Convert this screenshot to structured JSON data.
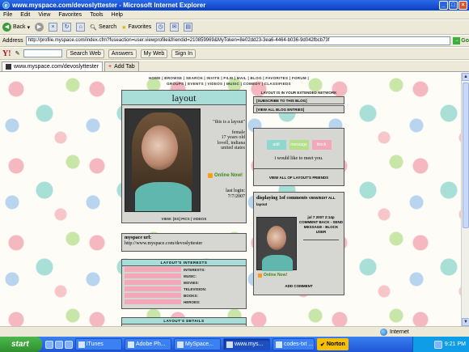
{
  "window": {
    "title": "www.myspace.com/devoslyttester - Microsoft Internet Explorer"
  },
  "menu": [
    "File",
    "Edit",
    "View",
    "Favorites",
    "Tools",
    "Help"
  ],
  "toolbar": {
    "back_label": "Back",
    "search_label": "Search",
    "favorites_label": "Favorites"
  },
  "address": {
    "label": "Address",
    "url": "http://profile.myspace.com/index.cfm?fuseaction=user.viewprofile&friendid=210859969&MyToken=8e02dd23-3ea6-4464-b036-9d042fbcb73f",
    "go_label": "Go"
  },
  "yahoo_toolbar": {
    "search_web_label": "Search Web",
    "answers_label": "Answers",
    "my_web_label": "My Web",
    "sign_in_label": "Sign In"
  },
  "tabs": [
    {
      "label": "www.myspace.com/devoslyttester"
    },
    {
      "label": "Add Tab"
    }
  ],
  "page": {
    "top_nav": "HOME | BROWSE | SEARCH | INVITE | FILM | MAIL | BLOG | FAVORITES | FORUM | GROUPS | EVENTS | VIDEOS | MUSIC | COMEDY | CLASSIFIEDS",
    "profile": {
      "title": "layout",
      "quote": "\"this is a layout\"",
      "details": "female\n17 years old\nlovell, indiana\nunited states",
      "online_label": "Online Now!",
      "last_login_label": "last login:",
      "last_login_value": "7/7/2007",
      "view_pics_label": "VIEW: [ES] PICS | VIDEOS"
    },
    "url_section": {
      "label": "myspace url:",
      "value": "http://www.myspace.com/devoslyttester"
    },
    "interests": {
      "header": "LAYOUT'S INTERESTS",
      "rows": [
        "INTERESTS:",
        "MUSIC:",
        "MOVIES:",
        "TELEVISION:",
        "BOOKS:",
        "HEROES:"
      ]
    },
    "details": {
      "header": "LAYOUT'S DETAILS"
    },
    "network": {
      "title": "LAYOUT IS IN YOUR EXTENDED NETWORK",
      "rows": [
        "[SUBSCRIBE TO THIS BLOG]",
        "[VIEW ALL BLOG ENTRIES]"
      ]
    },
    "contact": {
      "add_label": "add",
      "message_label": "message",
      "block_label": "block",
      "text": "i would like to meet you."
    },
    "friends": {
      "label": "VIEW ALL OF LAYOUT'S FRIENDS"
    },
    "comments": {
      "heading": "displaying 1of comments",
      "view_edit": "VIEW/EDIT ALL",
      "author": "layout",
      "date": "jul 7 2007 2:14p",
      "actions": "COMMENT BACK - SEND MESSAGE - BLOCK USER",
      "online_label": "Online Now!",
      "add_comment_label": "ADD COMMENT"
    }
  },
  "statusbar": {
    "zone_label": "Internet"
  },
  "taskbar": {
    "start_label": "start",
    "tasks": [
      "iTunes",
      "Adobe Ph...",
      "MySpace...",
      "www.mys...",
      "codes-txt ..."
    ],
    "norton_label": "Norton",
    "clock": "9:21 PM"
  }
}
